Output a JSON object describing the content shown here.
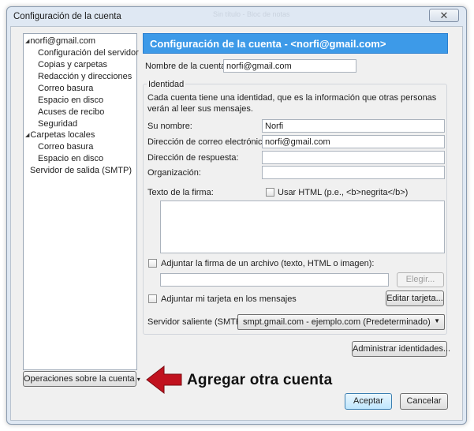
{
  "window": {
    "title": "Configuración de la cuenta",
    "faint_title": "Sin título - Bloc de notas",
    "close_glyph": "✕"
  },
  "sidebar": {
    "items": [
      {
        "label": "norfi@gmail.com",
        "level": 0,
        "expanded": true
      },
      {
        "label": "Configuración del servidor",
        "level": 1
      },
      {
        "label": "Copias y carpetas",
        "level": 1
      },
      {
        "label": "Redacción y direcciones",
        "level": 1
      },
      {
        "label": "Correo basura",
        "level": 1
      },
      {
        "label": "Espacio en disco",
        "level": 1
      },
      {
        "label": "Acuses de recibo",
        "level": 1
      },
      {
        "label": "Seguridad",
        "level": 1
      },
      {
        "label": "Carpetas locales",
        "level": 0,
        "expanded": true
      },
      {
        "label": "Correo basura",
        "level": 1
      },
      {
        "label": "Espacio en disco",
        "level": 1
      },
      {
        "label": "Servidor de salida (SMTP)",
        "level": 0
      }
    ],
    "operations_button": "Operaciones sobre la cuenta",
    "operations_chevron": "▾"
  },
  "main": {
    "header": "Configuración de la cuenta - <norfi@gmail.com>",
    "account_name_label": "Nombre de la cuenta:",
    "account_name_value": "norfi@gmail.com",
    "identity": {
      "group_title": "Identidad",
      "description": "Cada cuenta tiene una identidad, que es la información que otras personas verán al leer sus mensajes.",
      "name_label": "Su nombre:",
      "name_value": "Norfi",
      "email_label": "Dirección de correo electrónico:",
      "email_value": "norfi@gmail.com",
      "reply_label": "Dirección de respuesta:",
      "reply_value": "",
      "org_label": "Organización:",
      "org_value": "",
      "signature_label": "Texto de la firma:",
      "use_html_label": "Usar HTML (p.e., <b>negrita</b>)",
      "use_html_checked": false,
      "attach_signature_label": "Adjuntar la firma de un archivo (texto, HTML o imagen):",
      "attach_signature_checked": false,
      "signature_file_value": "",
      "choose_button": "Elegir...",
      "attach_card_label": "Adjuntar mi tarjeta en los mensajes",
      "attach_card_checked": false,
      "edit_card_button": "Editar tarjeta...",
      "smtp_label": "Servidor saliente (SMTP):",
      "smtp_value": "smpt.gmail.com - ejemplo.com (Predeterminado)"
    },
    "manage_identities_button": "Administrar identidades..."
  },
  "annotation": {
    "text": "Agregar otra cuenta",
    "arrow_color": "#c1121f"
  },
  "footer": {
    "accept_button": "Aceptar",
    "cancel_button": "Cancelar"
  },
  "colors": {
    "header_bg": "#3d9ae8",
    "window_bg": "#f0f0f0"
  }
}
